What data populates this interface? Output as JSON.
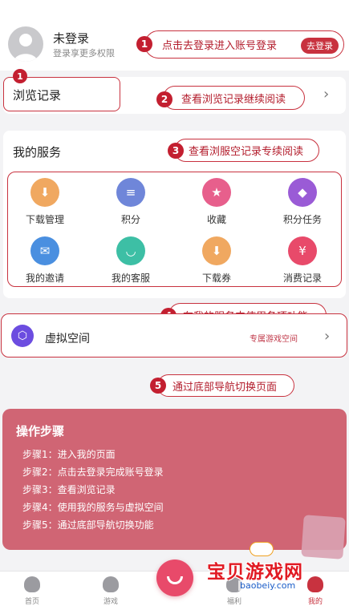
{
  "header": {
    "user_name": "未登录",
    "user_subtitle": "登录享更多权限",
    "login_button": "去登录"
  },
  "history": {
    "label": "浏览记录"
  },
  "services": {
    "title": "我的服务",
    "items": [
      {
        "label": "下载管理",
        "icon": "download-icon",
        "color": "#f0a860"
      },
      {
        "label": "积分",
        "icon": "coin-stack-icon",
        "color": "#6f86d9"
      },
      {
        "label": "收藏",
        "icon": "star-folder-icon",
        "color": "#e75f8c"
      },
      {
        "label": "积分任务",
        "icon": "diamond-icon",
        "color": "#9a5bd6"
      },
      {
        "label": "我的邀请",
        "icon": "invitation-icon",
        "color": "#4a8fe0"
      },
      {
        "label": "我的客服",
        "icon": "customer-service-icon",
        "color": "#3dbfa5"
      },
      {
        "label": "下载券",
        "icon": "download-coupon-icon",
        "color": "#f0a860"
      },
      {
        "label": "消费记录",
        "icon": "receipt-icon",
        "color": "#e84a6a"
      }
    ]
  },
  "virtual_space": {
    "label": "虚拟空间",
    "note": "专属游戏空间"
  },
  "callouts": [
    {
      "num": "1",
      "text": "点击去登录进入账号登录"
    },
    {
      "num": "1",
      "text": ""
    },
    {
      "num": "2",
      "text": "查看浏览记录继续阅读"
    },
    {
      "num": "3",
      "text": "查看浏服空记录专续阅读"
    },
    {
      "num": "4",
      "text": "在我的服务中使用各项功能"
    },
    {
      "num": "5",
      "text": "通过底部导航切换页面"
    }
  ],
  "steps": {
    "title": "操作步骤",
    "items": [
      "步骤1：进入我的页面",
      "步骤2：点击去登录完成账号登录",
      "步骤3：查看浏览记录",
      "步骤4：使用我的服务与虚拟空间",
      "步骤5：通过底部导航切换功能"
    ]
  },
  "tabbar": {
    "tabs": [
      {
        "label": "首页",
        "icon": "ghost-home-icon"
      },
      {
        "label": "游戏",
        "icon": "game-pad-icon"
      },
      {
        "label": "福利",
        "icon": "gift-icon"
      },
      {
        "label": "我的",
        "icon": "profile-icon"
      }
    ]
  },
  "watermark": {
    "text": "宝贝游戏网",
    "url": "baobeiy.com"
  },
  "colors": {
    "accent": "#c8323f",
    "steps_background": "#d06574",
    "center_button": "#e84a6a"
  }
}
